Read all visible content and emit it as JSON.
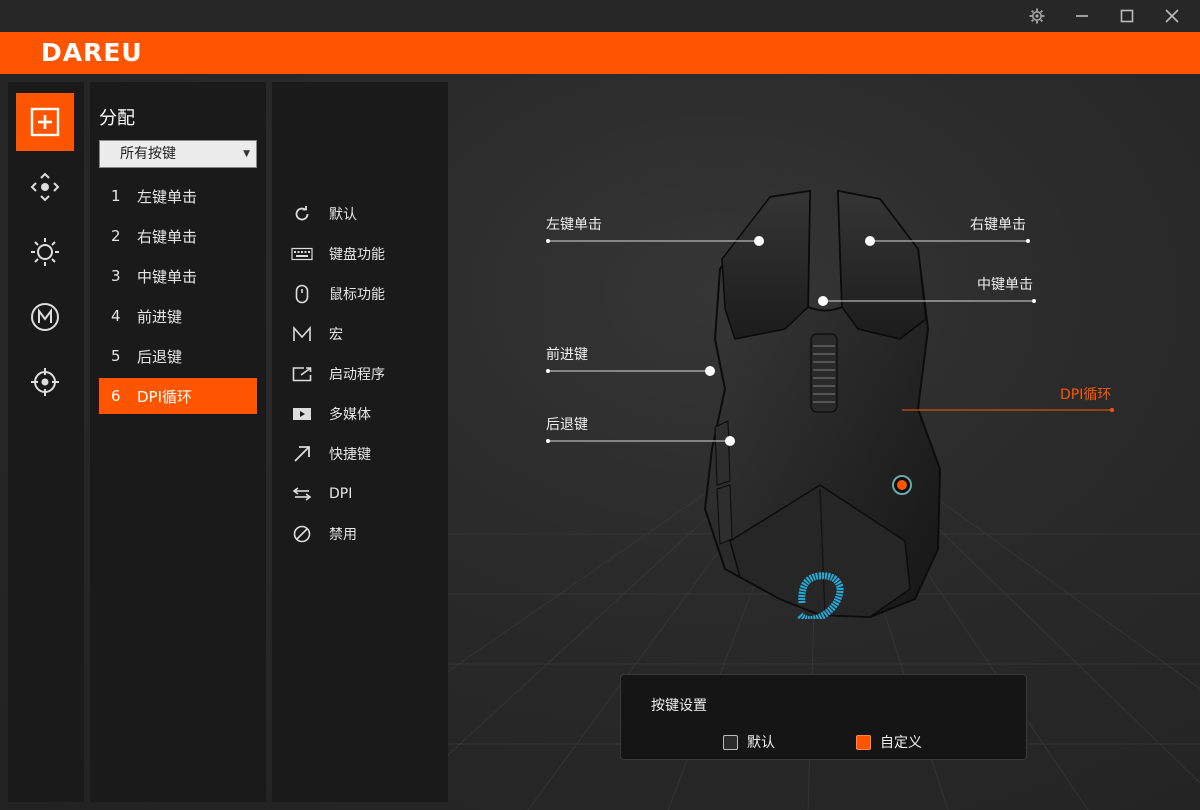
{
  "app": {
    "logo": "DAREU"
  },
  "assign": {
    "title": "分配",
    "filter": "所有按键",
    "items": [
      {
        "num": "1",
        "label": "左键单击"
      },
      {
        "num": "2",
        "label": "右键单击"
      },
      {
        "num": "3",
        "label": "中键单击"
      },
      {
        "num": "4",
        "label": "前进键"
      },
      {
        "num": "5",
        "label": "后退键"
      },
      {
        "num": "6",
        "label": "DPI循环"
      }
    ],
    "selected": "DPI循环"
  },
  "functions": [
    {
      "label": "默认",
      "icon": "refresh-icon"
    },
    {
      "label": "键盘功能",
      "icon": "keyboard-icon"
    },
    {
      "label": "鼠标功能",
      "icon": "mouse-icon"
    },
    {
      "label": "宏",
      "icon": "macro-icon"
    },
    {
      "label": "启动程序",
      "icon": "launch-icon"
    },
    {
      "label": "多媒体",
      "icon": "media-icon"
    },
    {
      "label": "快捷键",
      "icon": "shortcut-arrow-icon"
    },
    {
      "label": "DPI",
      "icon": "swap-arrows-icon"
    },
    {
      "label": "禁用",
      "icon": "disable-icon"
    }
  ],
  "callouts": {
    "left_click": "左键单击",
    "right_click": "右键单击",
    "middle_click": "中键单击",
    "forward": "前进键",
    "back": "后退键",
    "dpi": "DPI循环"
  },
  "key_settings": {
    "title": "按键设置",
    "options": [
      {
        "label": "默认",
        "checked": false
      },
      {
        "label": "自定义",
        "checked": true
      }
    ]
  },
  "colors": {
    "accent": "#ff5500",
    "background": "#1f1f1f",
    "panel": "#1a1a1a"
  },
  "nav_icons": [
    "assign-plus-icon",
    "move-arrows-icon",
    "brightness-icon",
    "macro-m-icon",
    "crosshair-icon"
  ]
}
